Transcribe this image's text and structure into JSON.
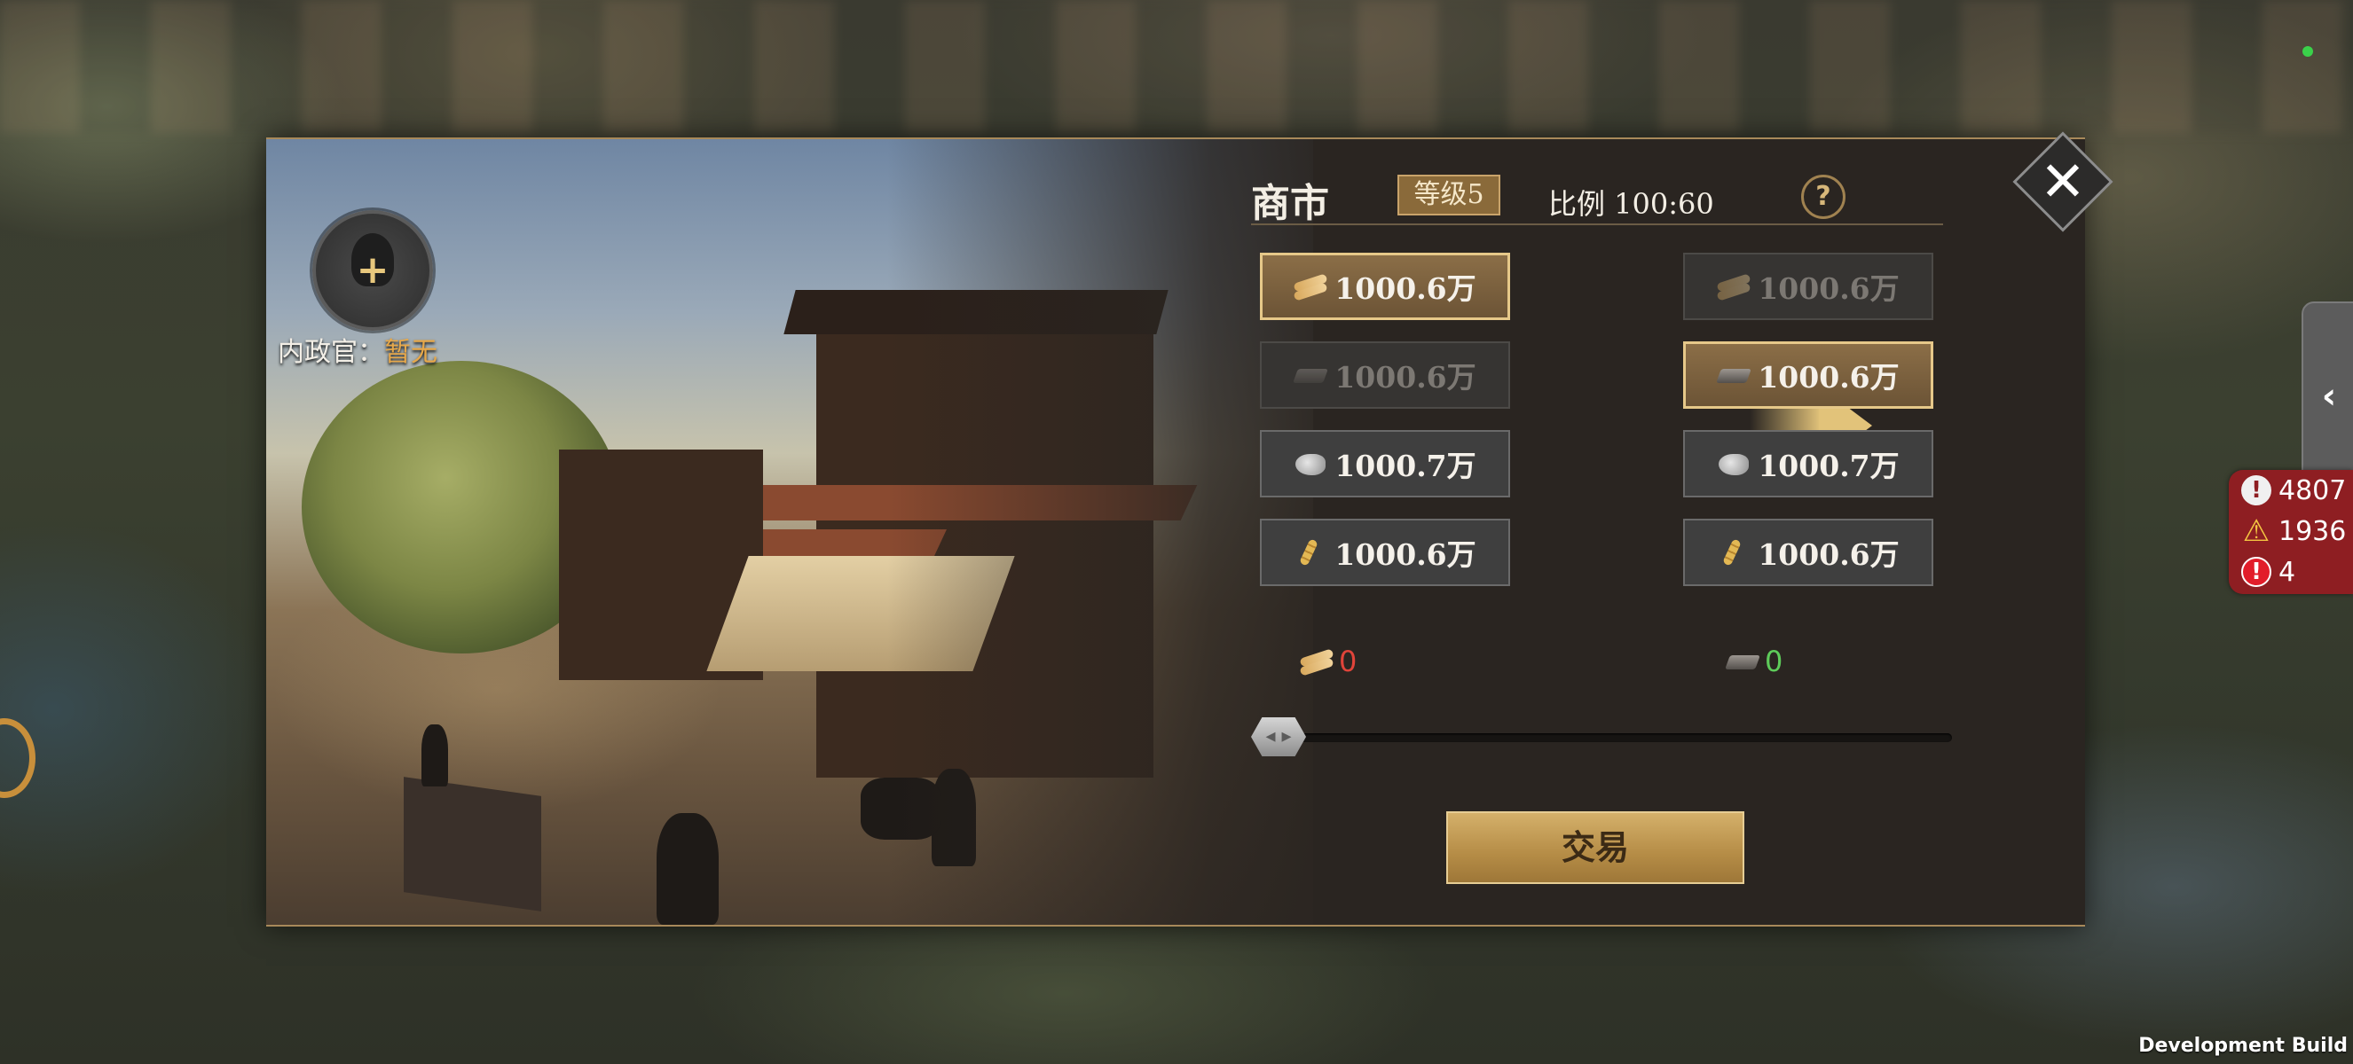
{
  "market": {
    "title": "商市",
    "level": "等级5",
    "ratio": "比例 100:60",
    "help": "?"
  },
  "official": {
    "label": "内政官：",
    "value": "暂无",
    "add_symbol": "+"
  },
  "left_resources": [
    {
      "icon": "wood-icon",
      "value": "1000.6万",
      "state": "selected"
    },
    {
      "icon": "iron-icon",
      "value": "1000.6万",
      "state": "disabled"
    },
    {
      "icon": "stone-icon",
      "value": "1000.7万",
      "state": "normal"
    },
    {
      "icon": "grain-icon",
      "value": "1000.6万",
      "state": "normal"
    }
  ],
  "right_resources": [
    {
      "icon": "wood-icon",
      "value": "1000.6万",
      "state": "disabled"
    },
    {
      "icon": "iron-icon",
      "value": "1000.6万",
      "state": "selected"
    },
    {
      "icon": "stone-icon",
      "value": "1000.7万",
      "state": "normal"
    },
    {
      "icon": "grain-icon",
      "value": "1000.6万",
      "state": "normal"
    }
  ],
  "amounts": {
    "give": "0",
    "receive": "0"
  },
  "slider": {
    "value": 0
  },
  "trade_button": "交易",
  "alerts": [
    {
      "icon": "info-circle-icon",
      "value": "4807"
    },
    {
      "icon": "warning-triangle-icon",
      "value": "1936"
    },
    {
      "icon": "alert-circle-icon",
      "value": "4"
    }
  ],
  "side_tab_arrow": "‹",
  "close_symbol": "✕",
  "dev_build": "Development Build",
  "colors": {
    "accent_gold": "#c9a36a",
    "give_amount": "#e0443a",
    "receive_amount": "#5ecb5a",
    "alert_bg": "#8e1e22"
  }
}
